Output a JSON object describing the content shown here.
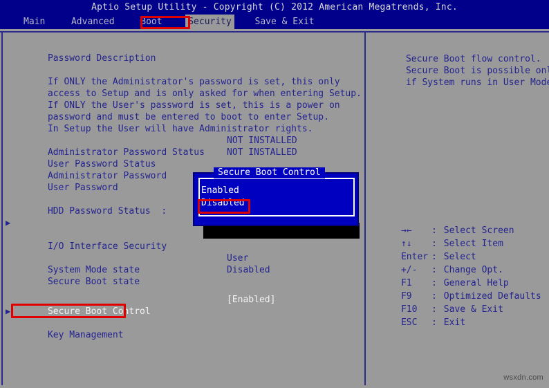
{
  "titlebar": {
    "text": "Aptio Setup Utility - Copyright (C) 2012 American Megatrends, Inc."
  },
  "menubar": {
    "items": [
      {
        "label": "Main",
        "active": false
      },
      {
        "label": "Advanced",
        "active": false
      },
      {
        "label": "Boot",
        "active": false
      },
      {
        "label": "Security",
        "active": true
      },
      {
        "label": "Save & Exit",
        "active": false
      }
    ]
  },
  "left_panel": {
    "heading": "Password Description",
    "description": [
      "If ONLY the Administrator's password is set, this only",
      "access to Setup and is only asked for when entering Setup.",
      "If ONLY the User's password is set, this is a power on",
      "password and must be entered to boot to enter Setup.",
      "In Setup the User will have Administrator rights."
    ],
    "rows": [
      {
        "label": "Administrator Password Status",
        "value": "NOT INSTALLED"
      },
      {
        "label": "User Password Status",
        "value": "NOT INSTALLED"
      },
      {
        "label": "Administrator Password",
        "value": ""
      },
      {
        "label": "User Password",
        "value": ""
      }
    ],
    "hdd_row": {
      "label": "HDD Password Status  :",
      "value": ""
    },
    "submenu_io": "I/O Interface Security",
    "state_rows": [
      {
        "label": "System Mode state",
        "value": "User"
      },
      {
        "label": "Secure Boot state",
        "value": "Disabled"
      }
    ],
    "secure_boot_control": {
      "label": "Secure Boot Control",
      "value": "[Enabled]"
    },
    "submenu_key": "Key Management"
  },
  "right_panel": {
    "help_text": [
      "Secure Boot flow control.",
      "Secure Boot is possible only",
      "if System runs in User Mode"
    ]
  },
  "legend": {
    "rows": [
      {
        "key": "→←",
        "sep": ":",
        "action": "Select Screen"
      },
      {
        "key": "↑↓",
        "sep": ":",
        "action": "Select Item"
      },
      {
        "key": "Enter",
        "sep": ":",
        "action": "Select"
      },
      {
        "key": "+/-",
        "sep": ":",
        "action": "Change Opt."
      },
      {
        "key": "F1",
        "sep": ":",
        "action": "General Help"
      },
      {
        "key": "F9",
        "sep": ":",
        "action": "Optimized Defaults"
      },
      {
        "key": "F10",
        "sep": ":",
        "action": "Save & Exit"
      },
      {
        "key": "ESC",
        "sep": ":",
        "action": "Exit"
      }
    ]
  },
  "popup": {
    "title": "Secure Boot Control",
    "options": [
      {
        "label": "Enabled",
        "highlighted": false
      },
      {
        "label": "Disabled",
        "highlighted": true
      }
    ]
  },
  "watermark": {
    "text": "wsxdn.com"
  },
  "colors": {
    "background": "#9a9a9a",
    "title_bar": "#00008b",
    "text_blue": "#23238f",
    "popup_blue": "#0000c0",
    "annotation_red": "#e00000",
    "selected_text": "#f4f4f4"
  }
}
